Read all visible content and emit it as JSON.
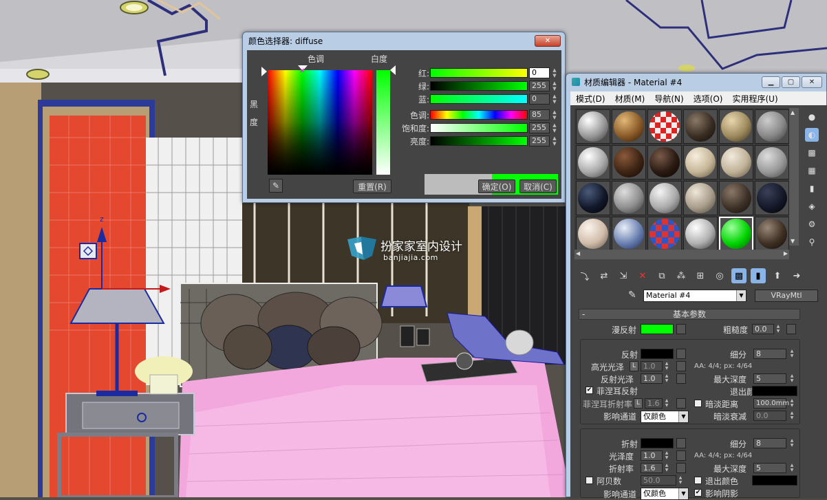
{
  "color_picker": {
    "title": "颜色选择器: diffuse",
    "hue_label": "色调",
    "whiteness_label": "白度",
    "blackness_label_1": "黑",
    "blackness_label_2": "度",
    "sliders": [
      {
        "label": "红:",
        "value": "0"
      },
      {
        "label": "绿:",
        "value": "255"
      },
      {
        "label": "蓝:",
        "value": "0"
      },
      {
        "label": "色调:",
        "value": "85"
      },
      {
        "label": "饱和度:",
        "value": "255"
      },
      {
        "label": "亮度:",
        "value": "255"
      }
    ],
    "reset_label": "重置(R)",
    "ok_label": "确定(O)",
    "cancel_label": "取消(C)",
    "old_color": "#bcbcbc",
    "new_color": "#00ff00",
    "close_glyph": "✕"
  },
  "material_editor": {
    "title": "材质编辑器 - Material #4",
    "menu": [
      "模式(D)",
      "材质(M)",
      "导航(N)",
      "选项(O)",
      "实用程序(U)"
    ],
    "material_name": "Material #4",
    "material_type": "VRayMtl",
    "rollout_title": "基本参数",
    "rollout_toggle": "-",
    "diffuse": {
      "label": "漫反射",
      "color": "#00ff00",
      "roughness_label": "粗糙度",
      "roughness": "0.0"
    },
    "reflect": {
      "label": "反射",
      "subdivs_label": "细分",
      "subdivs": "8",
      "hilight_label": "高光光泽",
      "hilight": "1.0",
      "lock": "L",
      "aa_info": "AA: 4/4; px: 4/64",
      "gloss_label": "反射光泽",
      "gloss": "1.0",
      "maxdepth_label": "最大深度",
      "maxdepth": "5",
      "fresnel_label": "菲涅耳反射",
      "fresnel_checked": "✔",
      "exit_label": "退出颜色",
      "fresnel_ior_label": "菲涅耳折射率",
      "fresnel_ior": "1.6",
      "dim_dist_label": "暗淡距离",
      "dim_dist": "100.0mm",
      "affect_label": "影响通道",
      "affect_value": "仅颜色",
      "dim_falloff_label": "暗淡衰减",
      "dim_falloff": "0.0"
    },
    "refract": {
      "label": "折射",
      "subdivs_label": "细分",
      "subdivs": "8",
      "gloss_label": "光泽度",
      "gloss": "1.0",
      "aa_info": "AA: 4/4; px: 4/64",
      "ior_label": "折射率",
      "ior": "1.6",
      "maxdepth_label": "最大深度",
      "maxdepth": "5",
      "abbe_label": "阿贝数",
      "abbe": "50.0",
      "exit_label": "退出颜色",
      "affect_label": "影响通道",
      "affect_value": "仅颜色",
      "shadows_label": "影响阴影",
      "shadows_checked": "✔"
    }
  },
  "watermark": {
    "title": "扮家家室内设计",
    "url": "banjiajia.com"
  },
  "viewport": {
    "axis_label": "z"
  }
}
